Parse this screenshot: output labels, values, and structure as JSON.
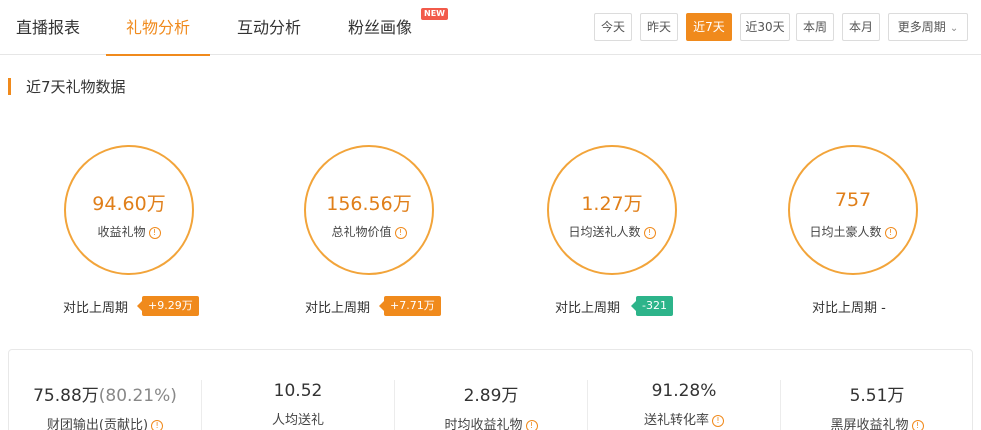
{
  "nav": {
    "tabs": [
      {
        "label": "直播报表"
      },
      {
        "label": "礼物分析"
      },
      {
        "label": "互动分析"
      },
      {
        "label": "粉丝画像"
      }
    ],
    "new_badge": "NEW",
    "periods": [
      "今天",
      "昨天",
      "近7天",
      "近30天",
      "本周",
      "本月"
    ],
    "more_periods": "更多周期"
  },
  "section": {
    "title": "近7天礼物数据"
  },
  "metrics": [
    {
      "value": "94.60万",
      "label": "收益礼物",
      "compare_label": "对比上周期",
      "change": "+9.29万"
    },
    {
      "value": "156.56万",
      "label": "总礼物价值",
      "compare_label": "对比上周期",
      "change": "+7.71万"
    },
    {
      "value": "1.27万",
      "label": "日均送礼人数",
      "compare_label": "对比上周期",
      "change": "-321"
    },
    {
      "value": "757",
      "label": "日均土豪人数",
      "compare_label": "对比上周期 -"
    }
  ],
  "stats": [
    {
      "value": "75.88万",
      "pct": "(80.21%)",
      "label": "财团输出(贡献比)"
    },
    {
      "value": "10.52",
      "label": "人均送礼"
    },
    {
      "value": "2.89万",
      "label": "时均收益礼物"
    },
    {
      "value": "91.28%",
      "label": "送礼转化率"
    },
    {
      "value": "5.51万",
      "label": "黑屏收益礼物"
    }
  ],
  "info_glyph": "!",
  "colors": {
    "accent": "#f08a1c",
    "up": "#f08a1c",
    "down": "#2db48a",
    "badge": "#f25a4a"
  }
}
